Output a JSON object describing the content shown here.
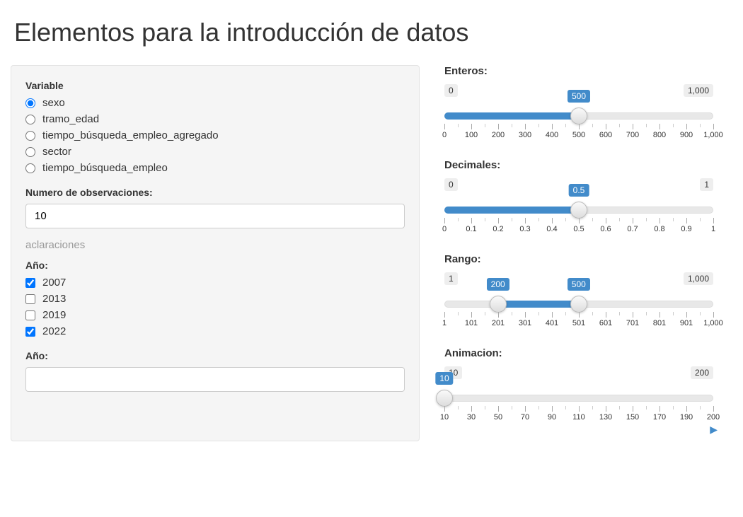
{
  "title": "Elementos para la introducción de datos",
  "variable": {
    "label": "Variable",
    "options": [
      {
        "value": "sexo",
        "checked": true
      },
      {
        "value": "tramo_edad",
        "checked": false
      },
      {
        "value": "tiempo_búsqueda_empleo_agregado",
        "checked": false
      },
      {
        "value": "sector",
        "checked": false
      },
      {
        "value": "tiempo_búsqueda_empleo",
        "checked": false
      }
    ]
  },
  "num_obs": {
    "label": "Numero de observaciones:",
    "value": "10"
  },
  "help": "aclaraciones",
  "year_check": {
    "label": "Año:",
    "options": [
      {
        "value": "2007",
        "checked": true
      },
      {
        "value": "2013",
        "checked": false
      },
      {
        "value": "2019",
        "checked": false
      },
      {
        "value": "2022",
        "checked": true
      }
    ]
  },
  "year_select": {
    "label": "Año:",
    "value": ""
  },
  "sliders": {
    "integer": {
      "label": "Enteros:",
      "min": "0",
      "max": "1,000",
      "value": "500",
      "pct": 50,
      "ticks": [
        "0",
        "100",
        "200",
        "300",
        "400",
        "500",
        "600",
        "700",
        "800",
        "900",
        "1,000"
      ]
    },
    "decimal": {
      "label": "Decimales:",
      "min": "0",
      "max": "1",
      "value": "0.5",
      "pct": 50,
      "ticks": [
        "0",
        "0.1",
        "0.2",
        "0.3",
        "0.4",
        "0.5",
        "0.6",
        "0.7",
        "0.8",
        "0.9",
        "1"
      ]
    },
    "range": {
      "label": "Rango:",
      "min": "1",
      "max": "1,000",
      "lo": "200",
      "lo_pct": 19.92,
      "hi": "500",
      "hi_pct": 49.95,
      "ticks": [
        "1",
        "101",
        "201",
        "301",
        "401",
        "501",
        "601",
        "701",
        "801",
        "901",
        "1,000"
      ]
    },
    "anim": {
      "label": "Animacion:",
      "min": "10",
      "max": "200",
      "value": "10",
      "pct": 0,
      "ticks": [
        "10",
        "30",
        "50",
        "70",
        "90",
        "110",
        "130",
        "150",
        "170",
        "190",
        "200"
      ]
    }
  }
}
